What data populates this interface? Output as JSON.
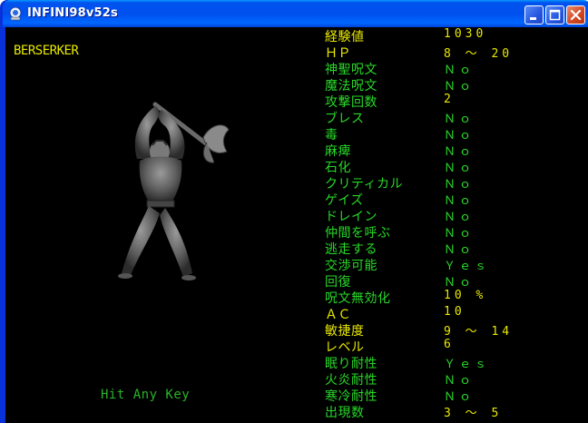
{
  "window": {
    "title": "INFINI98v52s"
  },
  "monster": {
    "name": "BERSERKER",
    "image": "axe-warrior-monster"
  },
  "prompt": "Hit Any Key",
  "colors": {
    "label": "#28d828",
    "highlight": "#e8e800",
    "background": "#000000",
    "titlebar": "#0053ee"
  },
  "stats": [
    {
      "label": "経験値",
      "value": "1030",
      "yellow": true
    },
    {
      "label": "ＨＰ",
      "value": "8 ～ 20",
      "yellow": true
    },
    {
      "label": "神聖呪文",
      "value": "Ｎｏ",
      "yellow": false
    },
    {
      "label": "魔法呪文",
      "value": "Ｎｏ",
      "yellow": false
    },
    {
      "label": "攻撃回数",
      "value": "2",
      "yellow": true
    },
    {
      "label": "ブレス",
      "value": "Ｎｏ",
      "yellow": false
    },
    {
      "label": "毒",
      "value": "Ｎｏ",
      "yellow": false
    },
    {
      "label": "麻痺",
      "value": "Ｎｏ",
      "yellow": false
    },
    {
      "label": "石化",
      "value": "Ｎｏ",
      "yellow": false
    },
    {
      "label": "クリティカル",
      "value": "Ｎｏ",
      "yellow": false
    },
    {
      "label": "ゲイズ",
      "value": "Ｎｏ",
      "yellow": false
    },
    {
      "label": "ドレイン",
      "value": "Ｎｏ",
      "yellow": false
    },
    {
      "label": "仲間を呼ぶ",
      "value": "Ｎｏ",
      "yellow": false
    },
    {
      "label": "逃走する",
      "value": "Ｎｏ",
      "yellow": false
    },
    {
      "label": "交渉可能",
      "value": "Ｙｅｓ",
      "yellow": false
    },
    {
      "label": "回復",
      "value": "Ｎｏ",
      "yellow": false
    },
    {
      "label": "呪文無効化",
      "value": "10 %",
      "yellow": true
    },
    {
      "label": "ＡＣ",
      "value": "10",
      "yellow": true
    },
    {
      "label": "敏捷度",
      "value": "9 ～ 14",
      "yellow": true
    },
    {
      "label": "レベル",
      "value": "6",
      "yellow": true
    },
    {
      "label": "眠り耐性",
      "value": "Ｙｅｓ",
      "yellow": false
    },
    {
      "label": "火炎耐性",
      "value": "Ｎｏ",
      "yellow": false
    },
    {
      "label": "寒冷耐性",
      "value": "Ｎｏ",
      "yellow": false
    },
    {
      "label": "出現数",
      "value": "3 ～ 5",
      "yellow": true
    }
  ]
}
